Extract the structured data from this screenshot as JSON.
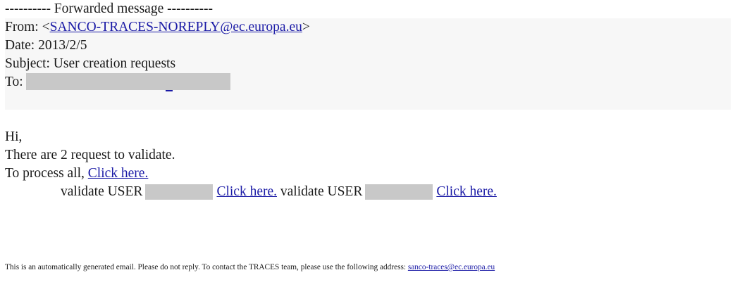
{
  "forward_header": {
    "separator": "---------- Forwarded message ----------",
    "from_label": "From:",
    "from_open": "<",
    "from_email": "SANCO-TRACES-NOREPLY@ec.europa.eu",
    "from_close": ">",
    "date_line": "Date: 2013/2/5",
    "subject_line": "Subject: User creation requests",
    "to_label": "To:"
  },
  "body": {
    "greeting": "Hi,",
    "request_line": "There are 2 request to validate.",
    "process_prefix": "To process all,",
    "process_link": "Click here.",
    "validate_label_1": "validate USER",
    "validate_link_1": "Click here.",
    "validate_label_2": "validate USER",
    "validate_link_2": "Click here."
  },
  "footer": {
    "text": "This is an automatically generated email. Please do not reply. To contact the TRACES team, please use the following address:",
    "email": "sanco-traces@ec.europa.eu"
  },
  "colors": {
    "link": "#1a1aa6",
    "header_background": "#f7f7f7",
    "redaction": "#c8c8c8"
  }
}
